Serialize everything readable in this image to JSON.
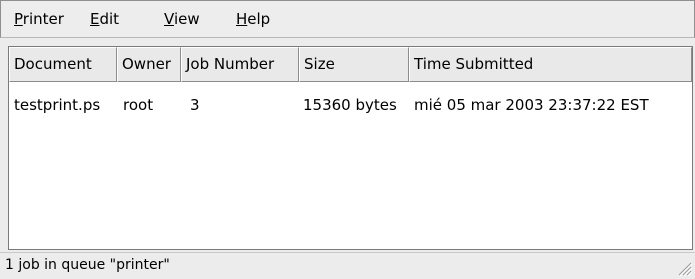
{
  "menubar": {
    "items": [
      {
        "mnemonic": "P",
        "rest": "rinter"
      },
      {
        "mnemonic": "E",
        "rest": "dit"
      },
      {
        "mnemonic": "V",
        "rest": "iew"
      },
      {
        "mnemonic": "H",
        "rest": "elp"
      }
    ]
  },
  "table": {
    "columns": [
      "Document",
      "Owner",
      "Job Number",
      "Size",
      "Time Submitted"
    ],
    "rows": [
      [
        "testprint.ps",
        "root",
        "3",
        "15360 bytes",
        "mié 05 mar 2003 23:37:22 EST"
      ]
    ]
  },
  "status": {
    "text": "1 job in queue \"printer\""
  }
}
